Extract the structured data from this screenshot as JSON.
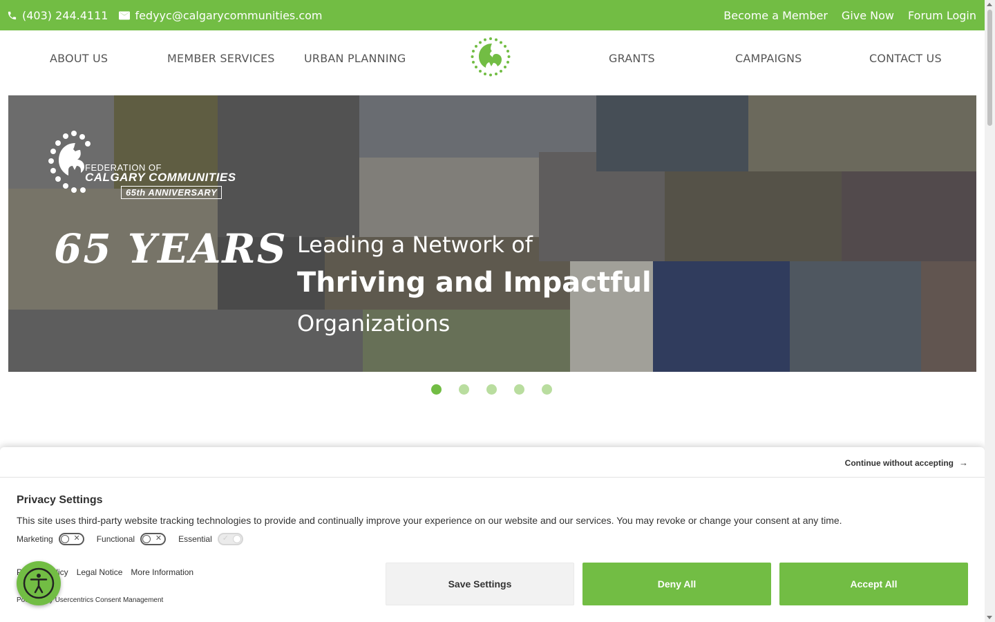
{
  "topbar": {
    "phone": "(403) 244.4111",
    "email": "fedyyc@calgarycommunities.com",
    "links": [
      "Become a Member",
      "Give Now",
      "Forum Login"
    ],
    "color": "#72bd44"
  },
  "nav": {
    "items": [
      "ABOUT US",
      "MEMBER SERVICES",
      "URBAN PLANNING",
      "GRANTS",
      "CAMPAIGNS",
      "CONTACT US"
    ]
  },
  "hero": {
    "logo_line1": "FEDERATION OF",
    "logo_line2": "CALGARY COMMUNITIES",
    "logo_line3": "65th ANNIVERSARY",
    "years": "65 YEARS",
    "tagline1": "Leading a Network of",
    "tagline2": "Thriving and Impactful",
    "tagline3": "Organizations",
    "slide_count": 5,
    "active_slide": 1
  },
  "consent": {
    "continue_label": "Continue without accepting",
    "title": "Privacy Settings",
    "text": "This site uses third-party website tracking technologies to provide and continually improve your experience on our website and our services. You may revoke or change your consent at any time.",
    "toggles": [
      {
        "label": "Marketing",
        "on": false
      },
      {
        "label": "Functional",
        "on": false
      },
      {
        "label": "Essential",
        "on": true,
        "disabled": true
      }
    ],
    "links": [
      "Privacy Policy",
      "Legal Notice",
      "More Information"
    ],
    "powered_by": "Powered by Usercentrics Consent Management",
    "buttons": {
      "save": "Save Settings",
      "deny": "Deny All",
      "accept": "Accept All"
    }
  }
}
